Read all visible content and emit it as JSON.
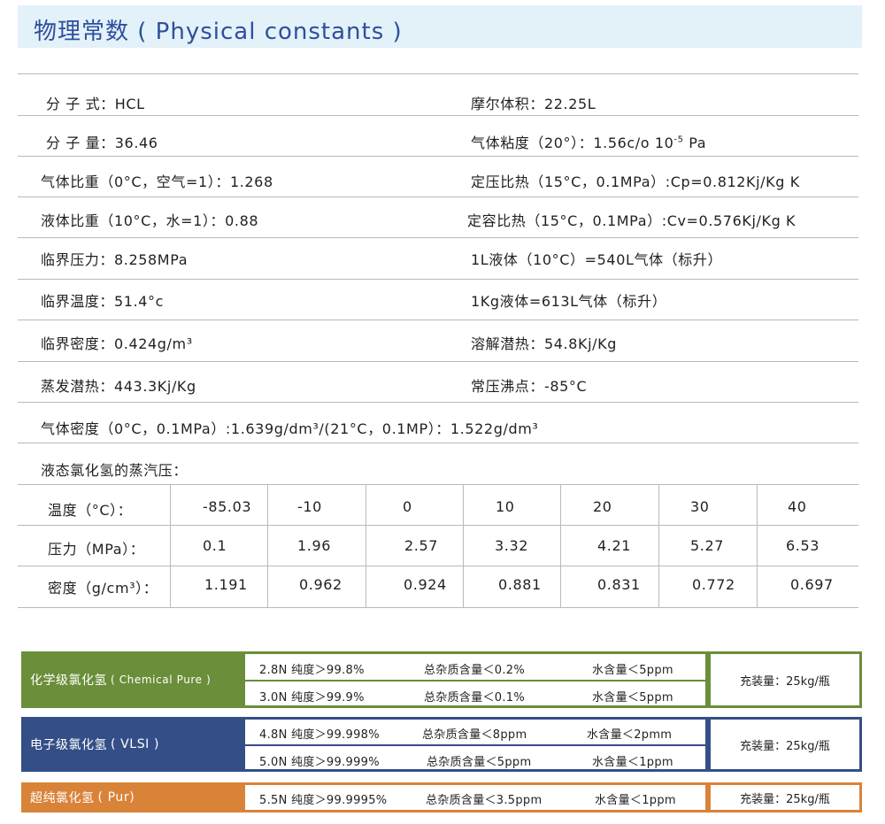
{
  "header": {
    "title": "物理常数 ( Physical constants )"
  },
  "properties": {
    "molecular_formula": "分  子 式：HCL",
    "molar_volume": "摩尔体积：22.25L",
    "molecular_weight": "分  子 量：36.46",
    "gas_viscosity_main": "气体粘度（20°）：1.56c/o 10",
    "gas_viscosity_exp": "-5",
    "gas_viscosity_unit": " Pa",
    "gas_specific_gravity": "气体比重（0°C，空气=1）：1.268",
    "cp": "定压比热（15°C，0.1MPa）:Cp=0.812Kj/Kg K",
    "liquid_specific_gravity": "液体比重（10°C，水=1）：0.88",
    "cv": "定容比热（15°C，0.1MPa）:Cv=0.576Kj/Kg K",
    "critical_pressure": "临界压力：8.258MPa",
    "liquid_gas_ratio": "1L液体（10°C）=540L气体（标升）",
    "critical_temperature": "临界温度：51.4°c",
    "kg_liquid_gas": "1Kg液体=613L气体（标升）",
    "critical_density": "临界密度：0.424g/m³",
    "heat_of_solution": "溶解潜热：54.8Kj/Kg",
    "heat_of_vaporization": "蒸发潜热：443.3Kj/Kg",
    "boiling_point": "常压沸点：-85°C",
    "gas_density": "气体密度（0°C，0.1MPa）:1.639g/dm³/(21°C，0.1MP）：1.522g/dm³",
    "vapor_pressure_title": "液态氯化氢的蒸汽压："
  },
  "vapor_table": {
    "rows": [
      {
        "label": "温度（°C）：",
        "values": [
          "-85.03",
          "-10",
          "0",
          "10",
          "20",
          "30",
          "40"
        ]
      },
      {
        "label": "压力（MPa）：",
        "values": [
          "0.1",
          "1.96",
          "2.57",
          "3.32",
          "4.21",
          "5.27",
          "6.53"
        ]
      },
      {
        "label": "密度（g/cm³）：",
        "values": [
          "1.191",
          "0.962",
          "0.924",
          "0.881",
          "0.831",
          "0.772",
          "0.697"
        ]
      }
    ]
  },
  "grades": [
    {
      "name": "化学级氯化氢",
      "name_en": "( Chemical Pure )",
      "color": "#6b8e3a",
      "specs": [
        {
          "purity": "2.8N 纯度＞99.8%",
          "impurity": "总杂质含量＜0.2%",
          "water": "水含量＜5ppm"
        },
        {
          "purity": "3.0N 纯度＞99.9%",
          "impurity": "总杂质含量＜0.1%",
          "water": "水含量＜5ppm"
        }
      ],
      "fill": "充装量：25kg/瓶"
    },
    {
      "name": "电子级氯化氢",
      "name_en": "( VLSI )",
      "color": "#344f87",
      "specs": [
        {
          "purity": "4.8N 纯度＞99.998%",
          "impurity": "总杂质含量＜8ppm",
          "water": "水含量＜2pmm"
        },
        {
          "purity": "5.0N 纯度＞99.999%",
          "impurity": "总杂质含量＜5ppm",
          "water": "水含量＜1ppm"
        }
      ],
      "fill": "充装量：25kg/瓶"
    },
    {
      "name": "超纯氯化氢",
      "name_en": "( Pur)",
      "color": "#d98339",
      "specs": [
        {
          "purity": "5.5N 纯度＞99.9995%",
          "impurity": "总杂质含量＜3.5ppm",
          "water": "水含量＜1ppm"
        }
      ],
      "fill": "充装量：25kg/瓶"
    }
  ]
}
